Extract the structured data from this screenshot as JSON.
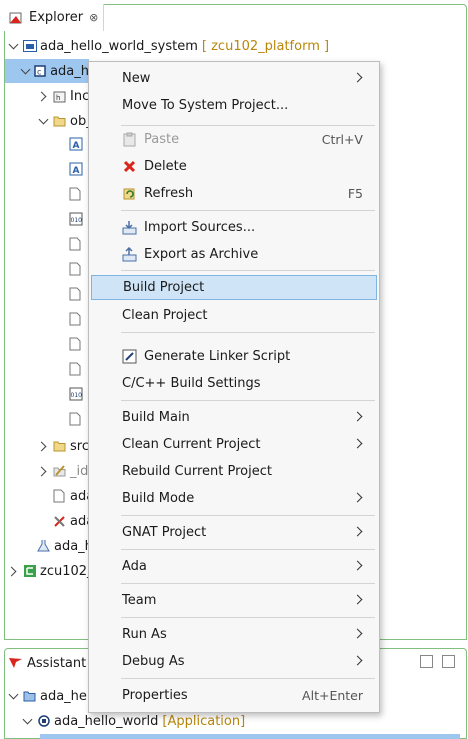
{
  "explorer": {
    "tab_label": "Explorer",
    "tab_close": "⊗",
    "rows": {
      "system": "ada_hello_world_system",
      "platform_tag": "[ zcu102_platform ]",
      "app": "ada_h",
      "includes": "Inc",
      "obj": "ob_",
      "src": "src",
      "ide": "_id",
      "file1": "ada",
      "file2": "ada",
      "file3": "ada_h",
      "platform": "zcu102_"
    }
  },
  "assistant": {
    "tab_label": "Assistant",
    "rows": {
      "system": "ada_hello",
      "app": "ada_hello_world",
      "app_tag": "[Application]"
    }
  },
  "menu": {
    "new": "New",
    "move_to_system": "Move To System Project...",
    "paste": "Paste",
    "paste_shortcut": "Ctrl+V",
    "delete": "Delete",
    "refresh": "Refresh",
    "refresh_shortcut": "F5",
    "import_sources": "Import Sources...",
    "export_archive": "Export as Archive",
    "build_project": "Build Project",
    "clean_project": "Clean Project",
    "generate_linker": "Generate Linker Script",
    "cpp_build_settings": "C/C++ Build Settings",
    "build_main": "Build Main",
    "clean_current": "Clean Current Project",
    "rebuild_current": "Rebuild Current Project",
    "build_mode": "Build Mode",
    "gnat_project": "GNAT Project",
    "ada": "Ada",
    "team": "Team",
    "run_as": "Run As",
    "debug_as": "Debug As",
    "properties": "Properties",
    "properties_shortcut": "Alt+Enter"
  }
}
